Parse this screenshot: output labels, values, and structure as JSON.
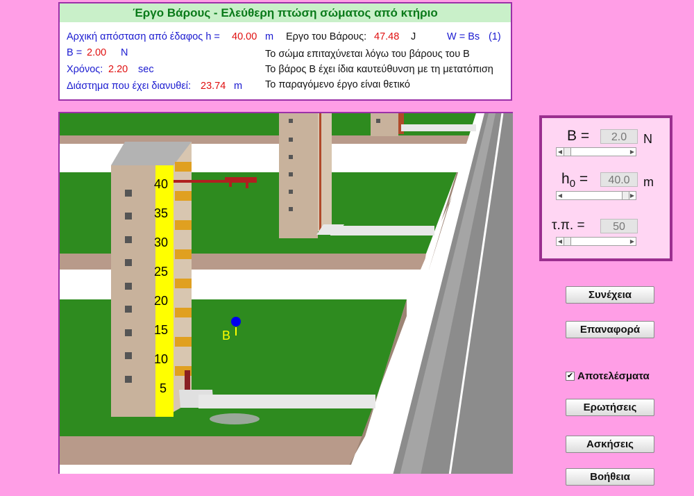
{
  "info": {
    "title": "Έργο Βάρους - Ελεύθερη πτώση σώματος από κτήριο",
    "height_label": "Αρχική απόσταση από έδαφος h = ",
    "height_value": "40.00",
    "height_unit": "m",
    "work_label": "Εργο του Βάρους:",
    "work_value": "47.48",
    "work_unit": "J",
    "formula": "W = Bs",
    "formula_ref": "(1)",
    "weight_label": "B = ",
    "weight_value": "2.00",
    "weight_unit": "N",
    "time_label": "Χρόνος:",
    "time_value": "2.20",
    "time_unit": "sec",
    "distance_label": "Διάστημα που έχει διανυθεί:",
    "distance_value": "23.74",
    "distance_unit": "m",
    "note1": "Το  σώμα επιταχύνεται λόγω του βάρους του Β",
    "note2": "Το βάρος Β έχει ίδια καυτεύθυνση με τη μετατόπιση",
    "note3": "Το παραγόμενο έργο είναι θετικό"
  },
  "scene": {
    "scale_labels": [
      "40",
      "35",
      "30",
      "25",
      "20",
      "15",
      "10",
      "5"
    ],
    "ball_label": "B"
  },
  "controls": {
    "weight": {
      "label": "B =",
      "value": "2.0",
      "unit": "N",
      "slider_fraction": 0.0
    },
    "height": {
      "label_main": "h",
      "label_sub": "0",
      "label_eq": " =",
      "value": "40.0",
      "unit": "m",
      "slider_fraction": 1.0
    },
    "tp": {
      "label": "τ.π. =",
      "value": "50",
      "slider_fraction": 0.0
    }
  },
  "buttons": {
    "continue": "Συνέχεια",
    "reset": "Επαναφορά",
    "results": "Αποτελέσματα",
    "questions": "Ερωτήσεις",
    "exercises": "Ασκήσεις",
    "help": "Βοήθεια"
  },
  "colors": {
    "background": "#ff9ee6",
    "title_bg": "#c9f0c9",
    "grass": "#2e8b1f",
    "scale": "#ffff00"
  }
}
